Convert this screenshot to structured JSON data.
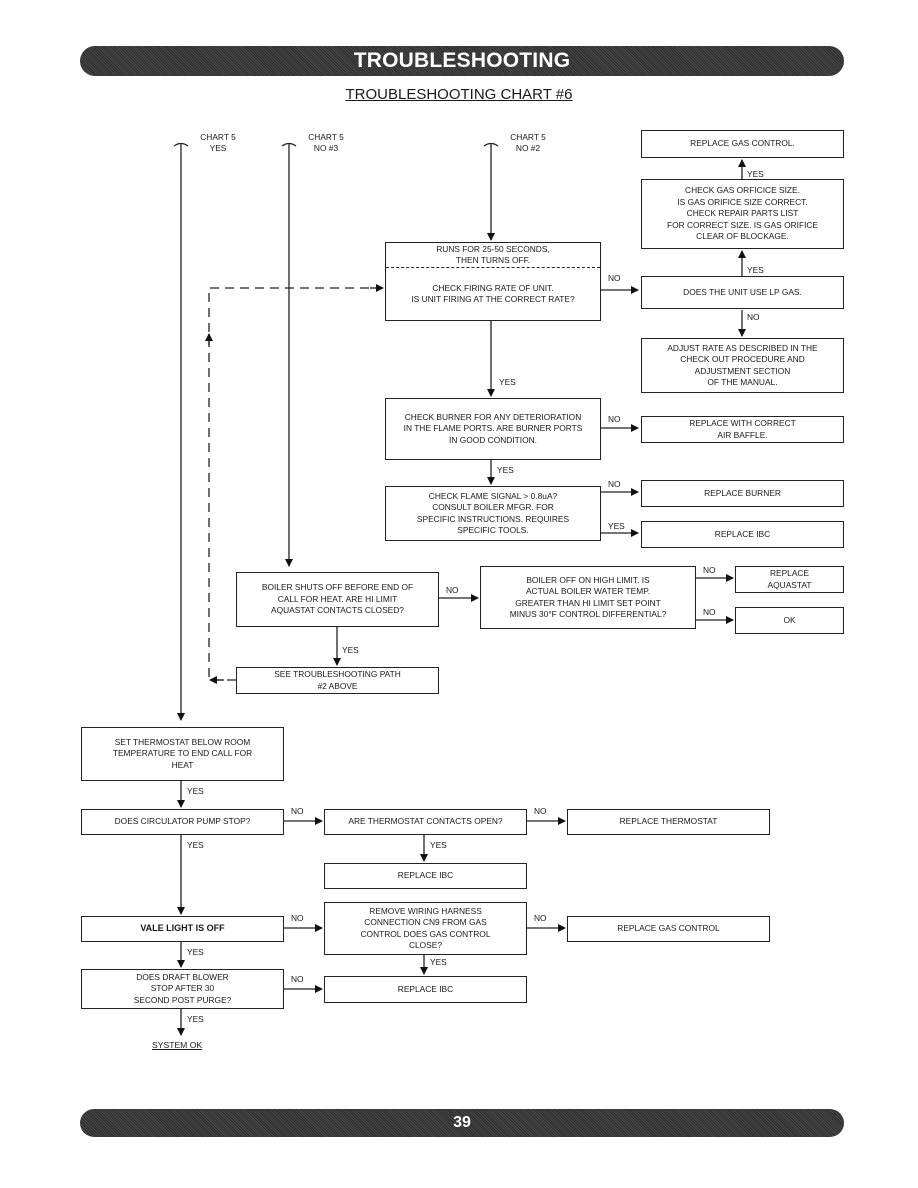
{
  "header": {
    "banner": "TROUBLESHOOTING",
    "chart_title": "TROUBLESHOOTING CHART #6"
  },
  "footer": {
    "page_number": "39"
  },
  "entries": {
    "chart5_yes": "CHART 5\nYES",
    "chart5_no3": "CHART 5\nNO #3",
    "chart5_no2": "CHART 5\nNO #2"
  },
  "boxes": {
    "runs": "RUNS FOR 25-50 SECONDS,\nTHEN TURNS OFF.",
    "firing_rate": "CHECK FIRING RATE OF UNIT.\nIS UNIT FIRING AT THE CORRECT RATE?",
    "replace_gas_control_top": "REPLACE GAS CONTROL.",
    "check_orifice": "CHECK GAS ORFICICE SIZE.\nIS GAS ORIFICE SIZE CORRECT.\nCHECK REPAIR PARTS LIST\nFOR CORRECT SIZE. IS GAS ORIFICE\nCLEAR OF BLOCKAGE.",
    "lp_gas": "DOES THE UNIT USE LP GAS.",
    "adjust_rate": "ADJUST RATE AS DESCRIBED IN THE\nCHECK OUT PROCEDURE AND\nADJUSTMENT SECTION\nOF THE MANUAL.",
    "check_burner": "CHECK BURNER FOR ANY DETERIORATION\nIN THE FLAME PORTS. ARE BURNER PORTS\nIN GOOD CONDITION.",
    "replace_air_baffle": "REPLACE WITH CORRECT\nAIR BAFFLE.",
    "flame_signal": "CHECK FLAME SIGNAL > 0.8uA?\nCONSULT BOILER MFGR. FOR\nSPECIFIC INSTRUCTIONS. REQUIRES\nSPECIFIC TOOLS.",
    "replace_burner": "REPLACE BURNER",
    "replace_ibc_1": "REPLACE IBC",
    "boiler_shuts_off": "BOILER SHUTS OFF BEFORE END OF\nCALL FOR HEAT. ARE HI LIMIT\nAQUASTAT CONTACTS CLOSED?",
    "boiler_high_limit": "BOILER OFF ON HIGH LIMIT. IS\nACTUAL BOILER WATER TEMP.\nGREATER THAN HI LIMIT SET POINT\nMINUS 30°F CONTROL DIFFERENTIAL?",
    "replace_aquastat": "REPLACE\nAQUASTAT",
    "ok": "OK",
    "see_path2": "SEE TROUBLESHOOTING PATH\n#2 ABOVE",
    "set_thermostat": "SET THERMOSTAT BELOW ROOM\nTEMPERATURE TO END CALL FOR\nHEAT",
    "circulator": "DOES CIRCULATOR PUMP STOP?",
    "thermostat_contacts": "ARE THERMOSTAT CONTACTS OPEN?",
    "replace_thermostat": "REPLACE THERMOSTAT",
    "replace_ibc_2": "REPLACE IBC",
    "vale_light": "VALE LIGHT IS OFF",
    "remove_harness": "REMOVE WIRING HARNESS\nCONNECTION CN9 FROM GAS\nCONTROL DOES GAS CONTROL\nCLOSE?",
    "replace_gas_control_bottom": "REPLACE GAS CONTROL",
    "draft_blower": "DOES DRAFT BLOWER\nSTOP AFTER 30\nSECOND POST PURGE?",
    "replace_ibc_3": "REPLACE IBC"
  },
  "labels": {
    "yes": "YES",
    "no": "NO"
  },
  "end": {
    "system_ok": "SYSTEM OK"
  }
}
